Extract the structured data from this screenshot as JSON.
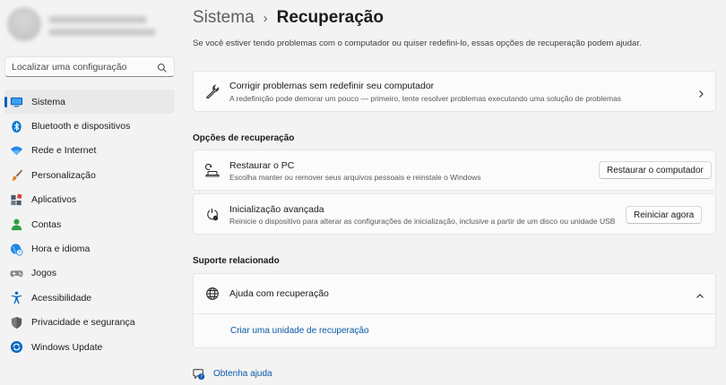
{
  "search": {
    "placeholder": "Localizar uma configuração"
  },
  "nav": {
    "items": [
      {
        "label": "Sistema",
        "icon": "system-icon",
        "color": "#0067c0",
        "active": true
      },
      {
        "label": "Bluetooth e dispositivos",
        "icon": "bluetooth-icon",
        "color": "#0078d4"
      },
      {
        "label": "Rede e Internet",
        "icon": "wifi-icon",
        "color": "#1e88e5"
      },
      {
        "label": "Personalização",
        "icon": "paintbrush-icon",
        "color": "#e67e22"
      },
      {
        "label": "Aplicativos",
        "icon": "apps-icon",
        "color": "#4a5a6a"
      },
      {
        "label": "Contas",
        "icon": "person-icon",
        "color": "#2ea043"
      },
      {
        "label": "Hora e idioma",
        "icon": "globe-clock-icon",
        "color": "#1e88e5"
      },
      {
        "label": "Jogos",
        "icon": "gamepad-icon",
        "color": "#707070"
      },
      {
        "label": "Acessibilidade",
        "icon": "accessibility-icon",
        "color": "#0a68c4"
      },
      {
        "label": "Privacidade e segurança",
        "icon": "shield-icon",
        "color": "#6b6b6b"
      },
      {
        "label": "Windows Update",
        "icon": "update-icon",
        "color": "#0a68c4"
      }
    ]
  },
  "breadcrumb": {
    "parent": "Sistema",
    "separator": "›",
    "current": "Recuperação"
  },
  "intro": "Se você estiver tendo problemas com o computador ou quiser redefini-lo, essas opções de recuperação podem ajudar.",
  "troubleshoot": {
    "title": "Corrigir problemas sem redefinir seu computador",
    "desc": "A redefinição pode demorar um pouco — primeiro, tente resolver problemas executando uma solução de problemas",
    "icon": "wrench-icon"
  },
  "recovery_options": {
    "heading": "Opções de recuperação",
    "reset": {
      "title": "Restaurar o PC",
      "desc": "Escolha manter ou remover seus arquivos pessoais e reinstale o Windows",
      "button": "Restaurar o computador",
      "icon": "reset-pc-icon"
    },
    "advanced": {
      "title": "Inicialização avançada",
      "desc": "Reinicie o dispositivo para alterar as configurações de inicialização, inclusive a partir de um disco ou unidade USB",
      "button": "Reiniciar agora",
      "icon": "advanced-startup-icon"
    }
  },
  "related": {
    "heading": "Suporte relacionado",
    "help": {
      "title": "Ajuda com recuperação",
      "icon": "globe-icon",
      "expanded": true
    },
    "link": "Criar uma unidade de recuperação"
  },
  "footer": {
    "help_link": "Obtenha ajuda"
  },
  "colors": {
    "accent": "#005fb8",
    "link": "#0a5aa8",
    "background": "#f3f3f3",
    "card": "#fbfbfb"
  }
}
